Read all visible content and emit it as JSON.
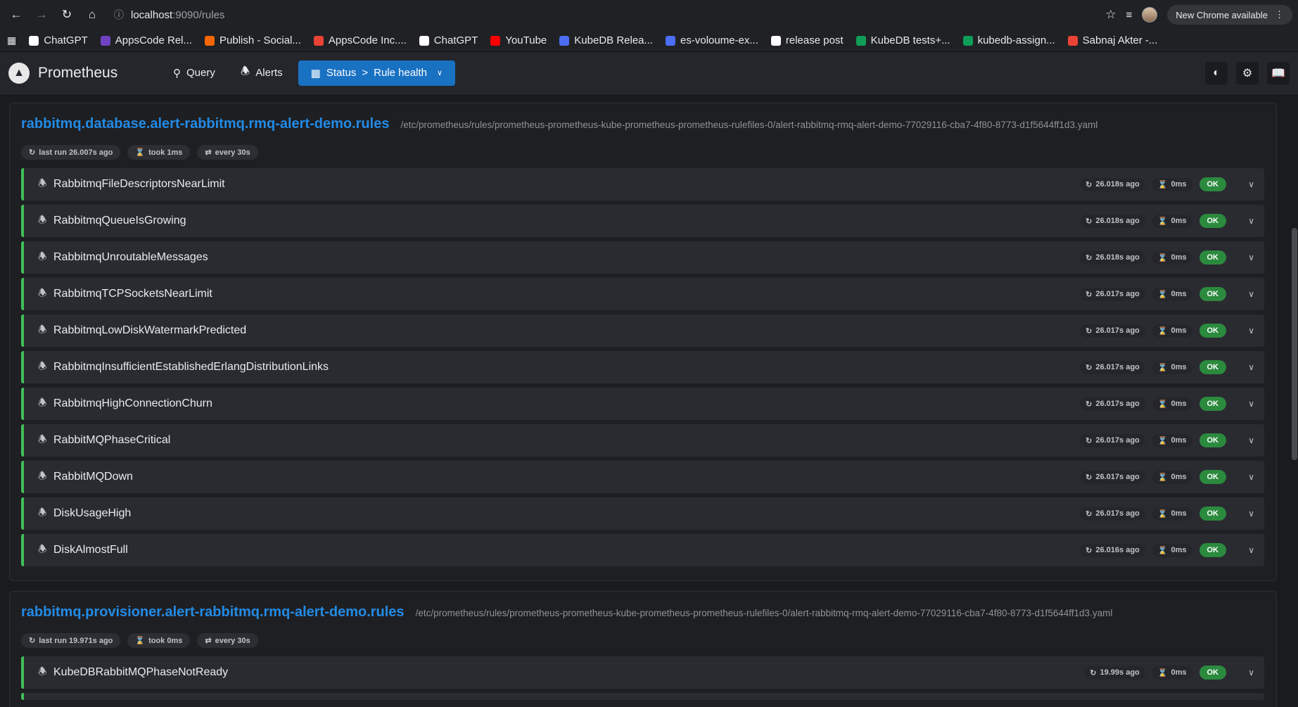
{
  "browser": {
    "host": "localhost",
    "path": ":9090/rules",
    "new_chrome": "New Chrome available",
    "bookmarks": [
      {
        "label": "ChatGPT",
        "color": "#ffffff"
      },
      {
        "label": "AppsCode Rel...",
        "color": "#6f42c1"
      },
      {
        "label": "Publish - Social...",
        "color": "#f76707"
      },
      {
        "label": "AppsCode Inc....",
        "color": "#ea4335"
      },
      {
        "label": "ChatGPT",
        "color": "#ffffff"
      },
      {
        "label": "YouTube",
        "color": "#ff0000"
      },
      {
        "label": "KubeDB Relea...",
        "color": "#4c6ef5"
      },
      {
        "label": "es-voloume-ex...",
        "color": "#4c6ef5"
      },
      {
        "label": "release post",
        "color": "#ffffff"
      },
      {
        "label": "KubeDB tests+...",
        "color": "#0f9d58"
      },
      {
        "label": "kubedb-assign...",
        "color": "#0f9d58"
      },
      {
        "label": "Sabnaj Akter -...",
        "color": "#ea4335"
      }
    ]
  },
  "app": {
    "name": "Prometheus",
    "nav": {
      "query": "Query",
      "alerts": "Alerts",
      "status": "Status",
      "sep": ">",
      "status_page": "Rule health"
    }
  },
  "groups": [
    {
      "name": "rabbitmq.database.alert-rabbitmq.rmq-alert-demo.rules",
      "file": "/etc/prometheus/rules/prometheus-prometheus-kube-prometheus-prometheus-rulefiles-0/alert-rabbitmq-rmq-alert-demo-77029116-cba7-4f80-8773-d1f5644ff1d3.yaml",
      "last_run": "last run 26.007s ago",
      "took": "took 1ms",
      "every": "every 30s",
      "rules": [
        {
          "name": "RabbitmqFileDescriptorsNearLimit",
          "ago": "26.018s ago",
          "dur": "0ms",
          "state": "OK"
        },
        {
          "name": "RabbitmqQueueIsGrowing",
          "ago": "26.018s ago",
          "dur": "0ms",
          "state": "OK"
        },
        {
          "name": "RabbitmqUnroutableMessages",
          "ago": "26.018s ago",
          "dur": "0ms",
          "state": "OK"
        },
        {
          "name": "RabbitmqTCPSocketsNearLimit",
          "ago": "26.017s ago",
          "dur": "0ms",
          "state": "OK"
        },
        {
          "name": "RabbitmqLowDiskWatermarkPredicted",
          "ago": "26.017s ago",
          "dur": "0ms",
          "state": "OK"
        },
        {
          "name": "RabbitmqInsufficientEstablishedErlangDistributionLinks",
          "ago": "26.017s ago",
          "dur": "0ms",
          "state": "OK"
        },
        {
          "name": "RabbitmqHighConnectionChurn",
          "ago": "26.017s ago",
          "dur": "0ms",
          "state": "OK"
        },
        {
          "name": "RabbitMQPhaseCritical",
          "ago": "26.017s ago",
          "dur": "0ms",
          "state": "OK"
        },
        {
          "name": "RabbitMQDown",
          "ago": "26.017s ago",
          "dur": "0ms",
          "state": "OK"
        },
        {
          "name": "DiskUsageHigh",
          "ago": "26.017s ago",
          "dur": "0ms",
          "state": "OK"
        },
        {
          "name": "DiskAlmostFull",
          "ago": "26.016s ago",
          "dur": "0ms",
          "state": "OK"
        }
      ]
    },
    {
      "name": "rabbitmq.provisioner.alert-rabbitmq.rmq-alert-demo.rules",
      "file": "/etc/prometheus/rules/prometheus-prometheus-kube-prometheus-prometheus-rulefiles-0/alert-rabbitmq-rmq-alert-demo-77029116-cba7-4f80-8773-d1f5644ff1d3.yaml",
      "last_run": "last run 19.971s ago",
      "took": "took 0ms",
      "every": "every 30s",
      "rules": [
        {
          "name": "KubeDBRabbitMQPhaseNotReady",
          "ago": "19.99s ago",
          "dur": "0ms",
          "state": "OK"
        }
      ]
    }
  ],
  "colors": {
    "accent": "#1971c2",
    "ok": "#2b8a3e",
    "rule_border": "#40c057",
    "group_title": "#228be6"
  }
}
